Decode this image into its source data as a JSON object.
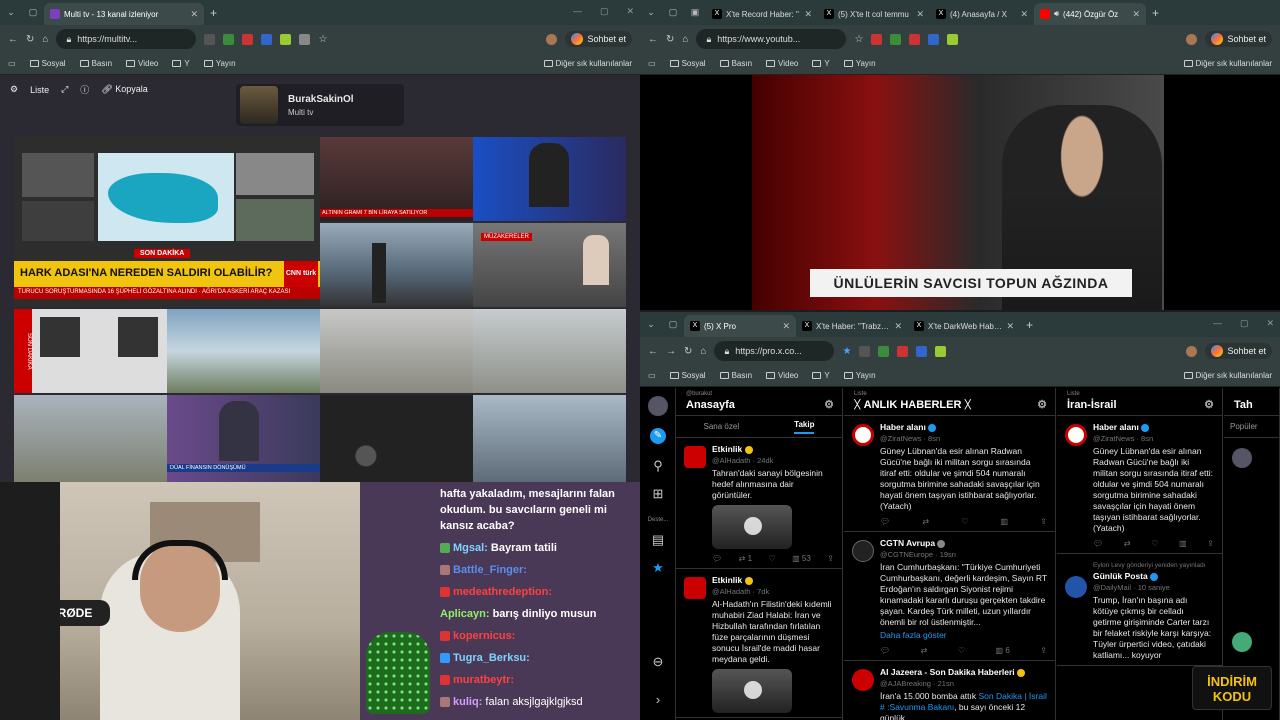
{
  "left": {
    "tab_title": "Multi tv - 13 kanal izleniyor",
    "url": "https://multitv...",
    "sohbet": "Sohbet et",
    "bookmarks": [
      "Sosyal",
      "Basın",
      "Video",
      "Y",
      "Yayın"
    ],
    "bookmarks_right": "Diğer sık kullanılanlar",
    "toolbar": {
      "liste": "Liste",
      "kopyala": "Kopyala"
    },
    "channel": {
      "name": "BurakSakinOl",
      "sub": "Multi tv"
    },
    "grid_texts": {
      "headline": "HARK ADASI'NA NEREDEN SALDIRI OLABİLİR?",
      "son_dakika": "SON DAKİKA",
      "tag1": "ALTININ GRAMI 7 BİN LİRAYA SATILIYOR",
      "tag2": "MÜZAKERELER",
      "ticker1": "TURUCU SORUŞTURMASINDA 16 ŞÜPHELİ GÖZALTINA ALINDI",
      "ticker2": "AĞRI'DA ASKERİ ARAÇ KAZASI",
      "sol": "SON DAKİKA",
      "cnn": "CNN türk",
      "dual": "DÜAL FİNANSIN DÖNÜŞÜMÜ"
    },
    "chat": {
      "intro": "hafta yakaladım, mesajlarını falan okudum. bu savcıların geneli mi kansız acaba?",
      "messages": [
        {
          "user": "Mgsal:",
          "text": "Bayram tatili"
        },
        {
          "user": "Battle_Finger:",
          "text": ""
        },
        {
          "user": "medeathredeption:",
          "text": ""
        },
        {
          "user": "Aplicayn:",
          "text": "barış dinliyo musun"
        },
        {
          "user": "kopernicus:",
          "text": ""
        },
        {
          "user": "Tugra_Berksu:",
          "text": ""
        },
        {
          "user": "muratbeytr:",
          "text": ""
        },
        {
          "user": "kuliq:",
          "text": "falan aksjlgajklgjksd"
        }
      ]
    },
    "mic_brand": "RØDE"
  },
  "right_top": {
    "tabs": [
      "X'te Record Haber: \"",
      "(5) X'te lt col temmu",
      "(4) Anasayfa / X",
      "(442) Özgür Öz"
    ],
    "url": "https://www.youtub...",
    "sohbet": "Sohbet et",
    "bookmarks": [
      "Sosyal",
      "Basın",
      "Video",
      "Y",
      "Yayın"
    ],
    "bookmarks_right": "Diğer sık kullanılanlar",
    "lower_third": "ÜNLÜLERİN SAVCISI TOPUN AĞZINDA"
  },
  "right_bottom": {
    "tabs": [
      "(5) X Pro",
      "X'te Haber: \"Trabzon'da kız ark",
      "X'te DarkWeb Haber: \"Bursa'da"
    ],
    "url": "https://pro.x.co...",
    "sohbet": "Sohbet et",
    "bookmarks": [
      "Sosyal",
      "Basın",
      "Video",
      "Y",
      "Yayın"
    ],
    "bookmarks_right": "Diğer sık kullanılanlar",
    "nav_label": "Deste...",
    "col1": {
      "small": "@burakut",
      "title": "Anasayfa",
      "subtab1": "Sana özel",
      "subtab2": "Takip",
      "t1": {
        "name": "Etkinlik",
        "handle": "@AlHadath · 24dk",
        "text": "Tahran'daki sanayi bölgesinin hedef alınmasına dair görüntüler.",
        "rt": "1",
        "likes": "53"
      },
      "t2": {
        "name": "Etkinlik",
        "handle": "@AlHadath · 7dk",
        "text": "Al-Hadath'ın Filistin'deki kıdemli muhabiri Ziad Halabi: İran ve Hizbullah tarafından fırlatılan füze parçalarının düşmesi sonucu İsrail'de maddi hasar meydana geldi."
      }
    },
    "col2": {
      "small": "Liste",
      "title": "ᚷ ANLIK HABERLER ᚷ",
      "t1": {
        "name": "Haber alanı",
        "handle": "@ZiratNews · 8sn",
        "text": "Güney Lübnan'da esir alınan Radwan Gücü'ne bağlı iki militan sorgu sırasında itiraf etti: oldular ve şimdi 504 numaralı sorgutma birimine sahadaki savaşçılar için hayati önem taşıyan istihbarat sağlıyorlar. (Yatach)"
      },
      "t2": {
        "name": "CGTN Avrupa",
        "handle": "@CGTNEurope · 19sn",
        "text": "İran Cumhurbaşkanı: \"Türkiye Cumhuriyeti Cumhurbaşkanı, değerli kardeşim, Sayın RT Erdoğan'ın saldırgan Siyonist rejimi kınamadaki kararlı duruşu gerçekten takdire şayan. Kardeş Türk milleti, uzun yıllardır önemli bir rol üstlenmiştir...",
        "more": "Daha fazla göster",
        "likes": "6"
      },
      "t3": {
        "name": "Al Jazeera - Son Dakika Haberleri",
        "handle": "@AJABreaking · 21sn",
        "text": "İran'a 15.000 bomba attık",
        "link": "Son Dakika | İsrail # :Savunma Bakanı",
        "tail": ", bu sayı önceki 12 günlük"
      }
    },
    "col3": {
      "small": "Liste",
      "title": "İran-İsrail",
      "t1": {
        "name": "Haber alanı",
        "handle": "@ZiratNews · 8sn",
        "text": "Güney Lübnan'da esir alınan Radwan Gücü'ne bağlı iki militan sorgu sırasında itiraf etti: oldular ve şimdi 504 numaralı sorgutma birimine sahadaki savaşçılar için hayati önem taşıyan istihbarat sağlıyorlar. (Yatach)"
      },
      "repost": "Eylon Levy gönderiyi yeniden yayınladı",
      "t2": {
        "name": "Günlük Posta",
        "handle": "@DailyMail · 10 saniye",
        "text": "Trump, İran'ın başına adı kötüye çıkmış bir celladı getirme girişiminde Carter tarzı bir felaket riskiyle karşı karşıya: Tüyler ürpertici video, çatıdaki katliamı... koyuyor"
      }
    },
    "col4": {
      "title": "Tah",
      "sub": "Popüler"
    },
    "badge": "İNDİRİM KODU"
  }
}
